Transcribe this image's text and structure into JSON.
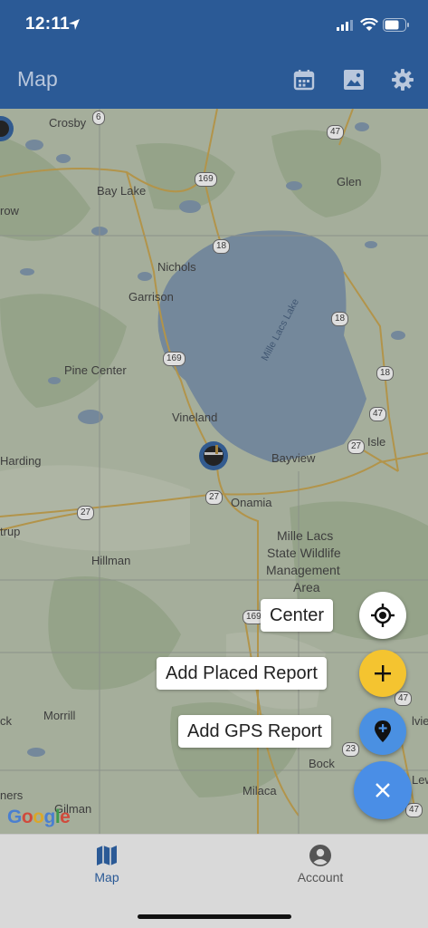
{
  "status_bar": {
    "time": "12:11"
  },
  "app_bar": {
    "title": "Map",
    "actions": [
      "calendar-icon",
      "image-icon",
      "gear-icon"
    ]
  },
  "map": {
    "places": [
      "Crosby",
      "Bay Lake",
      "Glen",
      "Nichols",
      "Garrison",
      "Mille Lacs Lake",
      "Pine Center",
      "Vineland",
      "Isle",
      "Bayview",
      "Onamia",
      "Harding",
      "Mille Lacs",
      "State Wildlife",
      "Management",
      "Area",
      "Hillman",
      "Morrill",
      "Bock",
      "Milaca",
      "Gilman",
      "row",
      "trup",
      "ck",
      "ners",
      "Lew",
      "lvie"
    ],
    "route_shields": [
      "6",
      "47",
      "169",
      "18",
      "169",
      "18",
      "18",
      "47",
      "27",
      "27",
      "27",
      "169",
      "47",
      "23",
      "47"
    ],
    "attribution": "Google"
  },
  "fab_menu": {
    "center_label": "Center",
    "add_placed_label": "Add Placed Report",
    "add_gps_label": "Add GPS Report",
    "colors": {
      "center": "#ffffff",
      "add_placed": "#f4c430",
      "add_gps": "#4a90e2",
      "close": "#4a8ee6"
    }
  },
  "bottom_nav": {
    "items": [
      {
        "label": "Map",
        "icon": "map-icon",
        "active": true
      },
      {
        "label": "Account",
        "icon": "account-icon",
        "active": false
      }
    ]
  }
}
